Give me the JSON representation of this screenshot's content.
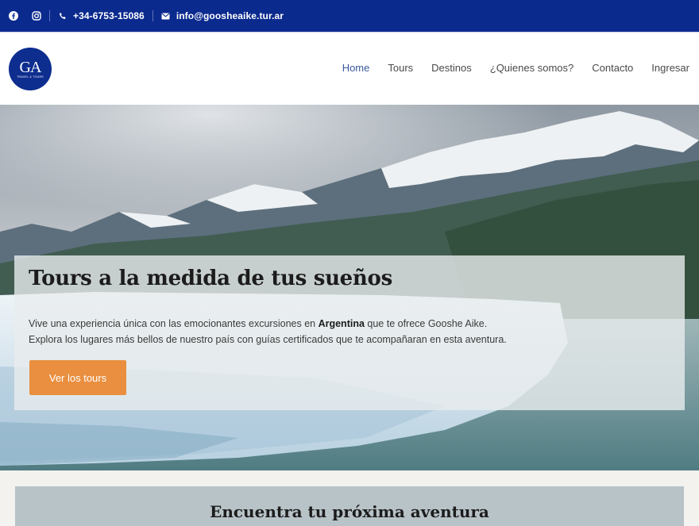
{
  "topbar": {
    "facebook_icon": "facebook-icon",
    "instagram_icon": "instagram-icon",
    "phone": "+34-6753-15086",
    "email": "info@goosheaike.tur.ar"
  },
  "header": {
    "logo_text": "GA",
    "logo_subtext": "TRAVEL & TOURS",
    "nav": [
      {
        "label": "Home",
        "active": true
      },
      {
        "label": "Tours"
      },
      {
        "label": "Destinos"
      },
      {
        "label": "¿Quienes somos?"
      },
      {
        "label": "Contacto"
      },
      {
        "label": "Ingresar"
      }
    ]
  },
  "hero": {
    "title": "Tours a la medida de tus sueños",
    "line1_prefix": "Vive una experiencia única con las emocionantes excursiones en ",
    "line1_bold": "Argentina",
    "line1_suffix": " que te ofrece Gooshe Aike.",
    "line2": "Explora los lugares más bellos de nuestro país con guías certificados que te acompañaran en esta aventura.",
    "button": "Ver los tours"
  },
  "section": {
    "title": "Encuentra tu próxima aventura"
  },
  "colors": {
    "topbar": "#0b2a8e",
    "accent_button": "#e98f3f",
    "nav_active": "#3b5a9d"
  }
}
